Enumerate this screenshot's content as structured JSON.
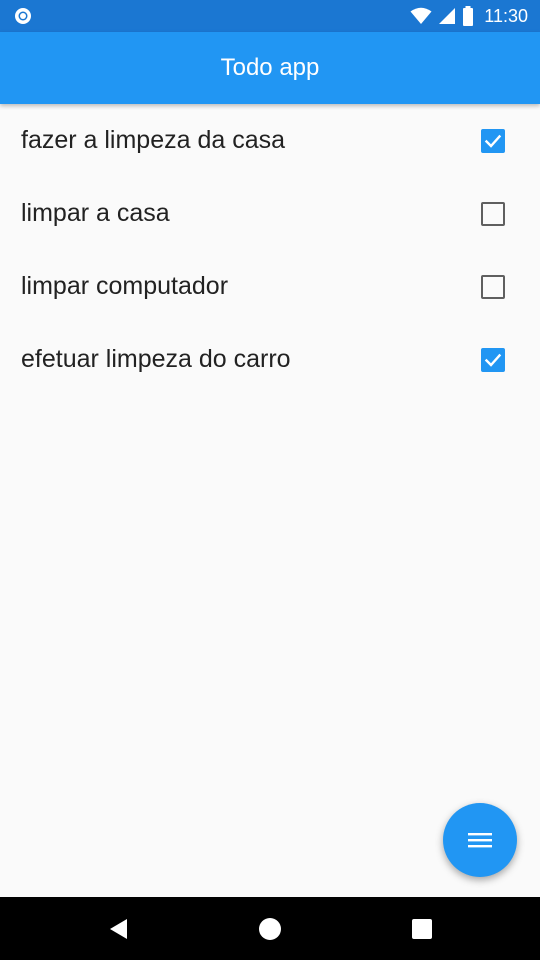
{
  "status_bar": {
    "time": "11:30",
    "icons": [
      "app-notification-icon",
      "wifi-icon",
      "signal-icon",
      "battery-icon"
    ]
  },
  "app_bar": {
    "title": "Todo app"
  },
  "todos": [
    {
      "label": "fazer a limpeza da casa",
      "checked": true
    },
    {
      "label": "limpar a casa",
      "checked": false
    },
    {
      "label": "limpar computador",
      "checked": false
    },
    {
      "label": "efetuar limpeza do carro",
      "checked": true
    }
  ],
  "fab": {
    "icon": "menu-icon"
  },
  "nav_bar": {
    "buttons": [
      "back-icon",
      "home-icon",
      "recents-icon"
    ]
  },
  "colors": {
    "primary": "#2196f3",
    "primary_dark": "#1b77d2",
    "background": "#fafafa",
    "text": "#222222"
  }
}
